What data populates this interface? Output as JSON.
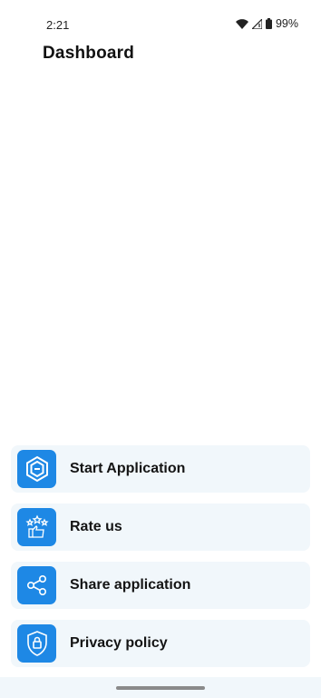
{
  "status_bar": {
    "time": "2:21",
    "battery": "99%",
    "icons": [
      "wifi-icon",
      "cell-signal-icon",
      "battery-icon"
    ]
  },
  "header": {
    "title": "Dashboard"
  },
  "menu": {
    "items": [
      {
        "label": "Start Application",
        "icon": "hexagon-logo-icon"
      },
      {
        "label": "Rate us",
        "icon": "thumbs-up-stars-icon"
      },
      {
        "label": "Share application",
        "icon": "share-icon"
      },
      {
        "label": "Privacy policy",
        "icon": "shield-lock-icon"
      }
    ]
  },
  "colors": {
    "accent": "#1e88e5",
    "card_background": "#f1f7fb",
    "text": "#141414"
  }
}
